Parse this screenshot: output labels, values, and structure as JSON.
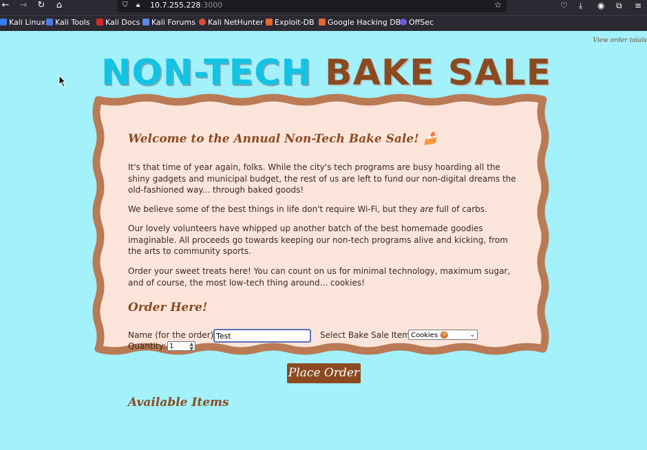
{
  "browser": {
    "url_host": "10.7.255.228",
    "url_port": ":3000",
    "bookmarks": [
      {
        "label": "Kali Linux",
        "icon": "kali-icon"
      },
      {
        "label": "Kali Tools",
        "icon": "kali-tools-icon"
      },
      {
        "label": "Kali Docs",
        "icon": "kali-docs-icon"
      },
      {
        "label": "Kali Forums",
        "icon": "kali-forums-icon"
      },
      {
        "label": "Kali NetHunter",
        "icon": "nethunter-icon"
      },
      {
        "label": "Exploit-DB",
        "icon": "exploitdb-icon"
      },
      {
        "label": "Google Hacking DB",
        "icon": "ghdb-icon"
      },
      {
        "label": "OffSec",
        "icon": "offsec-icon"
      }
    ]
  },
  "page": {
    "order_totals_link": "View order totals",
    "title_part1": "NON-TECH",
    "title_part2": "BAKE SALE",
    "welcome_heading": "Welcome to the Annual Non-Tech Bake Sale! 🍰",
    "paragraph1": "It's that time of year again, folks. While the city's tech programs are busy hoarding all the shiny gadgets and municipal budget, the rest of us are left to fund our non-digital dreams the old-fashioned way... through baked goods!",
    "paragraph2_before": "We believe some of the best things in life don't require Wi-Fi, but they ",
    "paragraph2_em": "are",
    "paragraph2_after": " full of carbs.",
    "paragraph3": "Our lovely volunteers have whipped up another batch of the best homemade goodies imaginable. All proceeds go towards keeping our non-tech programs alive and kicking, from the arts to community sports.",
    "paragraph4": "Order your sweet treats here! You can count on us for minimal technology, maximum sugar, and of course, the most low-tech thing around... cookies!",
    "order_heading": "Order Here!",
    "name_label": "Name (for the order):",
    "name_value": "Test",
    "item_label": "Select Bake Sale Item:",
    "item_selected": "Cookies 🍪",
    "quantity_label": "Quantity:",
    "quantity_value": "1",
    "place_order_label": "Place Order",
    "available_heading": "Available Items"
  },
  "colors": {
    "page_bg": "#a2f1fb",
    "title_cyan": "#12c3e3",
    "brown": "#8b4a20",
    "card_border": "#b97a55",
    "card_fill": "#fbe5db"
  }
}
